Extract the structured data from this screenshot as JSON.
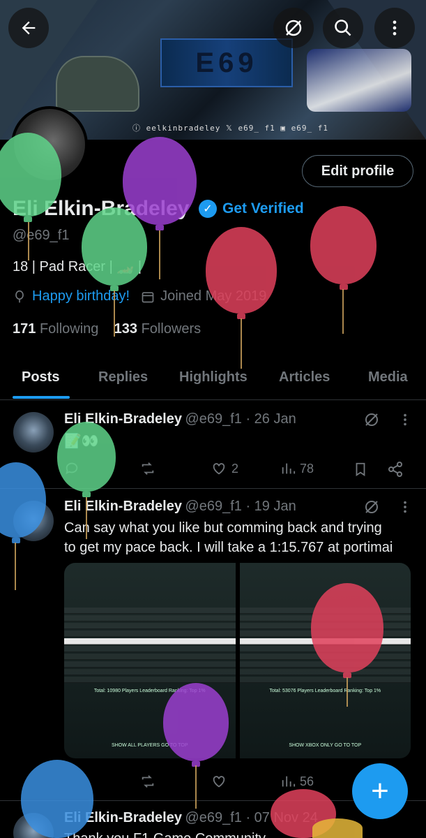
{
  "banner": {
    "logo_text": "E69",
    "socials": "ⓘ eelkinbradeley   𝕏 e69_ f1   ▣ e69_ f1"
  },
  "header": {
    "back_icon": "arrow-left-icon",
    "grok_icon": "slash-circle-icon",
    "search_icon": "search-icon",
    "more_icon": "more-vertical-icon"
  },
  "profile": {
    "edit_label": "Edit profile",
    "display_name": "Eli Elkin-Bradeley",
    "get_verified": "Get Verified",
    "handle": "@e69_f1",
    "bio": "18 | Pad Racer | 🏎️ |",
    "birthday": "Happy birthday!",
    "joined": "Joined May 2019",
    "following_count": "171",
    "following_label": "Following",
    "followers_count": "133",
    "followers_label": "Followers"
  },
  "tabs": [
    "Posts",
    "Replies",
    "Highlights",
    "Articles",
    "Media"
  ],
  "posts": [
    {
      "author": "Eli Elkin-Bradeley",
      "handle_time": "@e69_f1 · 26 Jan",
      "text": "📝👀",
      "likes": "2",
      "views": "78"
    },
    {
      "author": "Eli Elkin-Bradeley",
      "handle_time": "@e69_f1 · 19 Jan",
      "text_line1": "Can say what you like but comming back and trying",
      "text_line2": "to get my pace back. I will take a 1:15.767 at portimai",
      "views": "56",
      "left_footer": "Total: 10980 Players   Leaderboard Ranking: Top 1%",
      "right_footer": "Total: 53076 Players   Leaderboard Ranking: Top 1%",
      "left_btns": "SHOW ALL PLAYERS    GO TO TOP",
      "right_btns": "SHOW XBOX ONLY    GO TO TOP"
    },
    {
      "author": "Eli Elkin-Bradeley",
      "handle_time": "@e69_f1 · 07 Nov 24",
      "text": "Thank you F1 Game Community"
    }
  ],
  "fab_label": "+",
  "colors": {
    "accent": "#1d9bf0",
    "muted": "#71767b",
    "text": "#e7e9ea",
    "border": "#2f3336",
    "balloon_green": "#5fd38a",
    "balloon_purple": "#9b3fd0",
    "balloon_red": "#e0415c",
    "balloon_blue": "#3a8fe0"
  }
}
